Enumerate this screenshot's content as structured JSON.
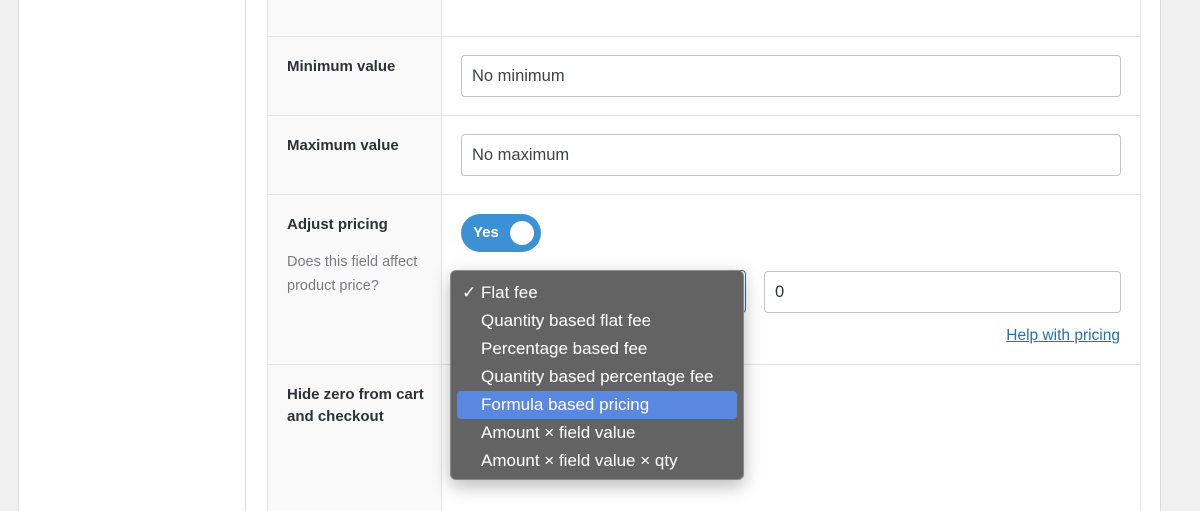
{
  "fields": {
    "minimum": {
      "label": "Minimum value",
      "placeholder": "No minimum"
    },
    "maximum": {
      "label": "Maximum value",
      "placeholder": "No maximum"
    },
    "adjust_pricing": {
      "label": "Adjust pricing",
      "description": "Does this field affect product price?",
      "toggle_label": "Yes",
      "toggle_on": true,
      "amount_value": "0",
      "help_link": "Help with pricing"
    },
    "hide_zero": {
      "label": "Hide zero from cart and checkout"
    }
  },
  "pricing_dropdown": {
    "check_mark": "✓",
    "selected": "Flat fee",
    "highlighted": "Formula based pricing",
    "options": [
      "Flat fee",
      "Quantity based flat fee",
      "Percentage based fee",
      "Quantity based percentage fee",
      "Formula based pricing",
      "Amount × field value",
      "Amount × field value × qty"
    ]
  },
  "colors": {
    "toggle": "#3c91d4",
    "link": "#2271b1",
    "dropdown_bg": "#636363",
    "dropdown_highlight": "#5a87e0"
  }
}
